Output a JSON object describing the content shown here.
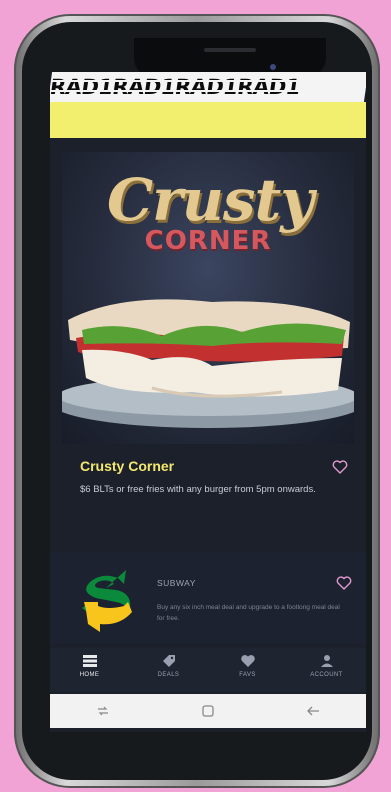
{
  "banner": {
    "text": "RAD1RAD1RAD1RAD1"
  },
  "featured": {
    "logo_line1": "Crusty",
    "logo_line2": "CORNER",
    "title": "Crusty Corner",
    "description": "$6 BLTs or free fries with any burger from 5pm onwards."
  },
  "deal": {
    "title": "SUBWAY",
    "description": "Buy any six inch meal deal and upgrade to a footlong meal deal for free."
  },
  "tabs": [
    {
      "label": "HOME",
      "icon": "home-icon",
      "active": true
    },
    {
      "label": "DEALS",
      "icon": "tag-icon",
      "active": false
    },
    {
      "label": "FAVS",
      "icon": "heart-icon",
      "active": false
    },
    {
      "label": "ACCOUNT",
      "icon": "person-icon",
      "active": false
    }
  ],
  "colors": {
    "accent_yellow": "#f2ee6e",
    "title_yellow": "#f2e86f",
    "heart_pink": "#e29bd0",
    "subway_green": "#0a8a3a",
    "subway_yellow": "#f7c51c",
    "background_pink": "#f2a3d6"
  }
}
